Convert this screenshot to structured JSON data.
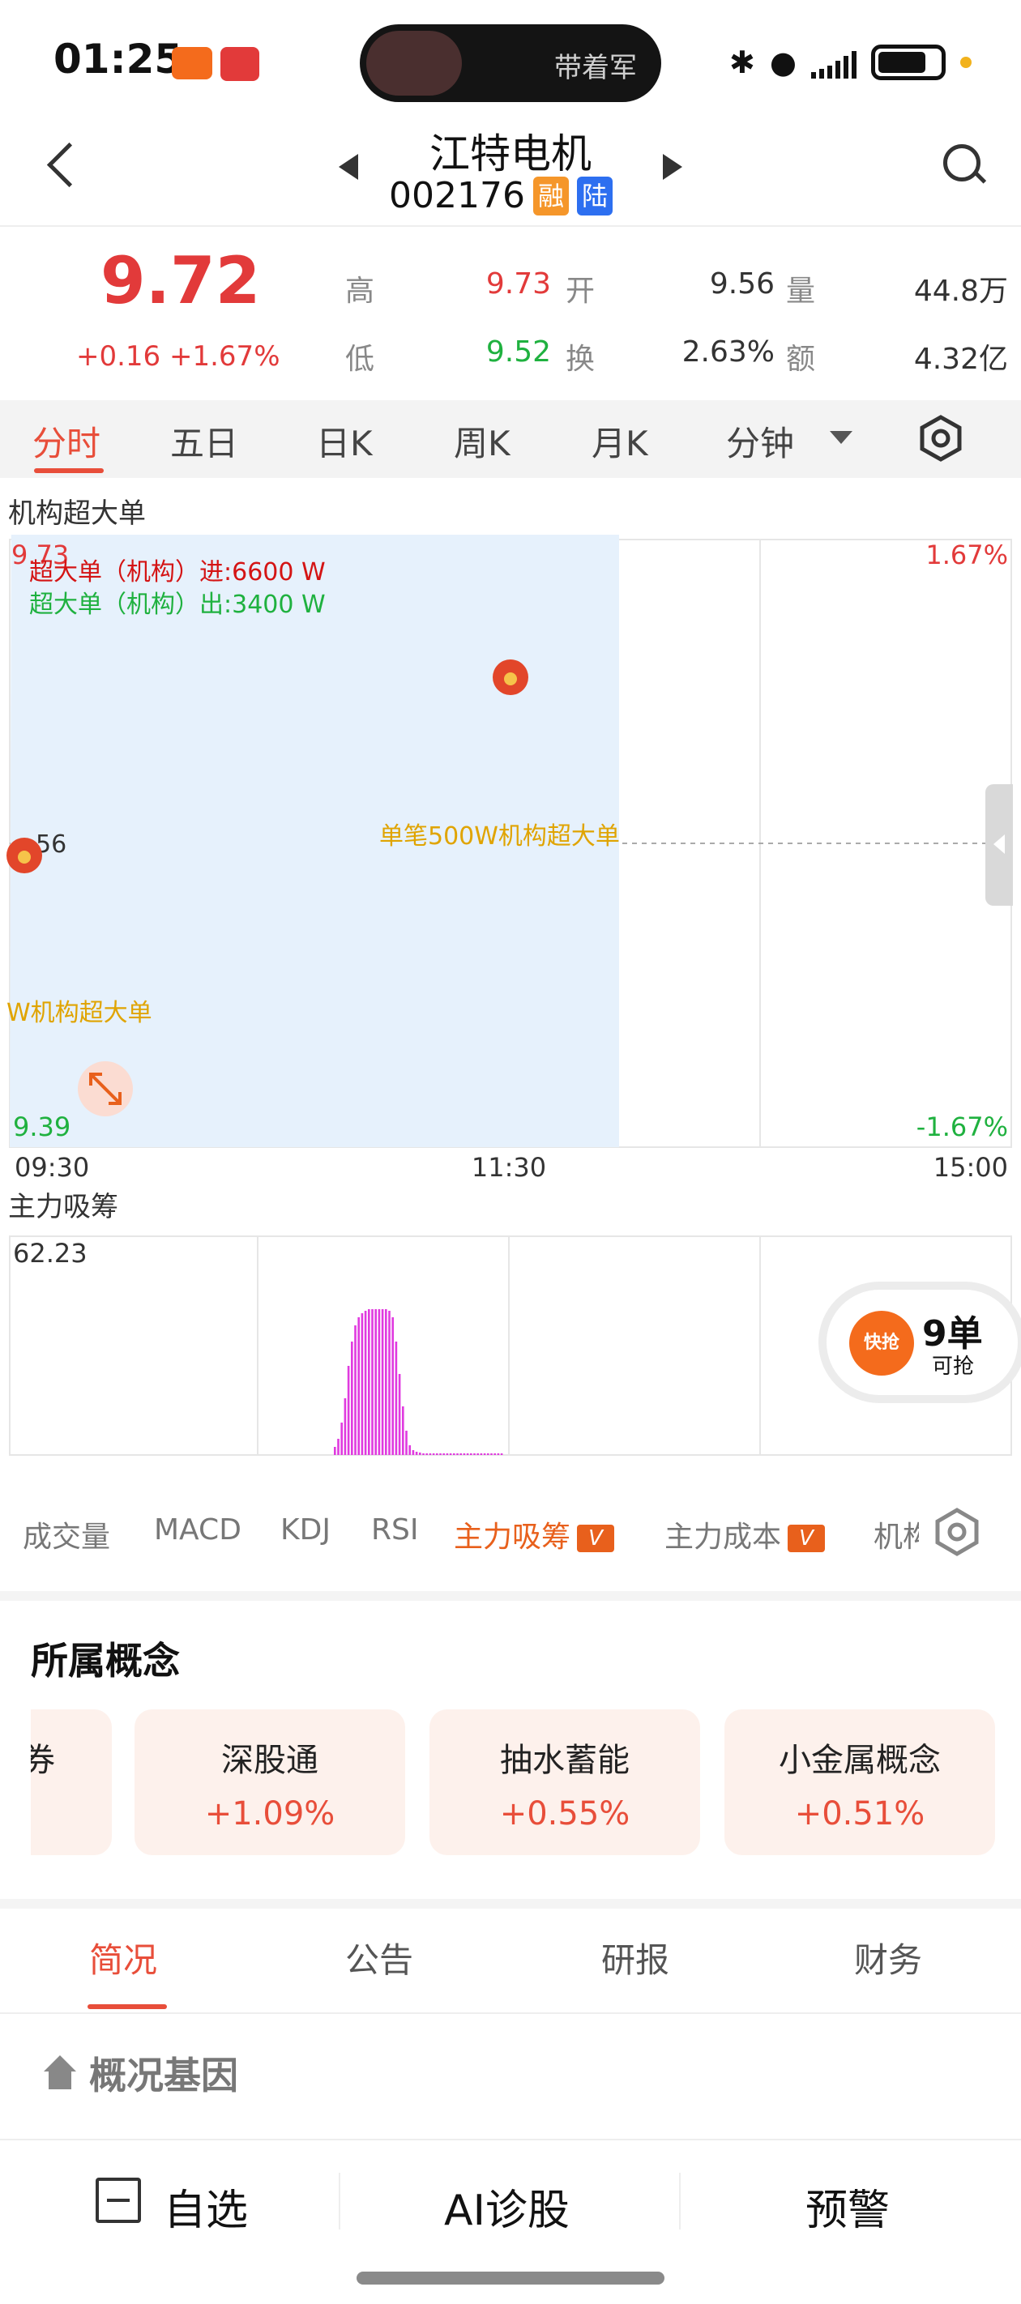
{
  "status_bar": {
    "time": "01:25",
    "pill_text": "带着军"
  },
  "header": {
    "stock_name": "江特电机",
    "stock_code": "002176",
    "tag_rong": "融",
    "tag_lu": "陆"
  },
  "quote": {
    "price": "9.72",
    "change": "+0.16  +1.67%",
    "rows": [
      {
        "l1": "高",
        "v1": "9.73",
        "l2": "开",
        "v2": "9.56",
        "l3": "量",
        "v3": "44.8万"
      },
      {
        "l1": "低",
        "v1": "9.52",
        "l2": "换",
        "v2": "2.63%",
        "l3": "额",
        "v3": "4.32亿"
      }
    ]
  },
  "tabs": [
    "分时",
    "五日",
    "日K",
    "周K",
    "月K",
    "分钟"
  ],
  "chart1": {
    "section_title": "机构超大单",
    "y_max_label": "9.73",
    "y_min_label": "9.39",
    "pct_max_label": "1.67%",
    "pct_min_label": "-1.67%",
    "mid_label": "56",
    "legend_in": "超大单（机构）进:6600 W",
    "legend_out": "超大单（机构）出:3400 W",
    "mid_annotation": "单笔500W机构超大单",
    "left_annotation": "W机构超大单",
    "x_labels": [
      "09:30",
      "11:30",
      "15:00"
    ]
  },
  "chart2": {
    "section_title": "主力吸筹",
    "max_label": "62.23"
  },
  "grab_badge": {
    "logo_text": "快抢",
    "count": "9单",
    "sub": "可抢"
  },
  "indicators": [
    "成交量",
    "MACD",
    "KDJ",
    "RSI",
    "主力吸筹",
    "主力成本",
    "机构"
  ],
  "indicator_badge": "V",
  "concepts": {
    "title": "所属概念",
    "items": [
      {
        "name": "深股通",
        "pct": "+1.09%"
      },
      {
        "name": "抽水蓄能",
        "pct": "+0.55%"
      },
      {
        "name": "小金属概念",
        "pct": "+0.51%"
      }
    ],
    "partial": {
      "name": "券",
      "pct": "%"
    }
  },
  "bottom_tabs": [
    "简况",
    "公告",
    "研报",
    "财务"
  ],
  "overview_title": "概况基因",
  "actions": [
    "自选",
    "AI诊股",
    "预警"
  ],
  "colors": {
    "up": "#e23a3a",
    "down": "#1fb13f",
    "accent": "#e84e3a",
    "line": "#3d8fd6",
    "avg_line": "#d9a31a",
    "bar": "#e03adf"
  }
}
